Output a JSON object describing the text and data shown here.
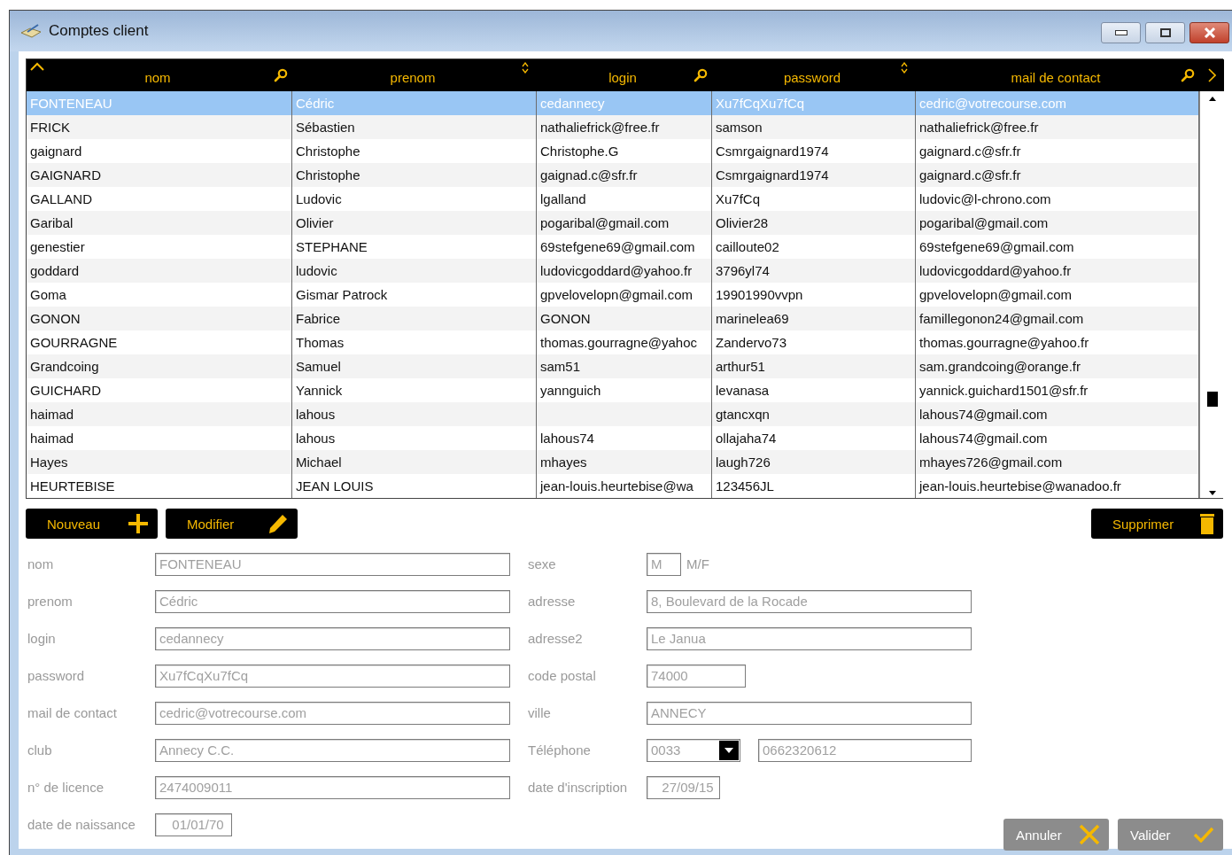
{
  "window": {
    "title": "Comptes client"
  },
  "table": {
    "columns": [
      {
        "label": "nom",
        "sorted_ascending": true,
        "sortable": false,
        "search": true
      },
      {
        "label": "prenom",
        "sorted_ascending": false,
        "sortable": true,
        "search": false
      },
      {
        "label": "login",
        "sorted_ascending": false,
        "sortable": false,
        "search": true
      },
      {
        "label": "password",
        "sorted_ascending": false,
        "sortable": true,
        "search": false
      },
      {
        "label": "mail de contact",
        "sorted_ascending": false,
        "sortable": false,
        "search": true
      }
    ],
    "rows": [
      {
        "nom": "FONTENEAU",
        "prenom": "Cédric",
        "login": "cedannecy",
        "password": "Xu7fCqXu7fCq",
        "mail_de_contact": "cedric@votrecourse.com",
        "selected": true
      },
      {
        "nom": "FRICK",
        "prenom": "Sébastien",
        "login": "nathaliefrick@free.fr",
        "password": "samson",
        "mail_de_contact": "nathaliefrick@free.fr",
        "selected": false
      },
      {
        "nom": "gaignard",
        "prenom": "Christophe",
        "login": "Christophe.G",
        "password": "Csmrgaignard1974",
        "mail_de_contact": "gaignard.c@sfr.fr",
        "selected": false
      },
      {
        "nom": "GAIGNARD",
        "prenom": "Christophe",
        "login": "gaignad.c@sfr.fr",
        "password": "Csmrgaignard1974",
        "mail_de_contact": "gaignard.c@sfr.fr",
        "selected": false
      },
      {
        "nom": "GALLAND",
        "prenom": "Ludovic",
        "login": "lgalland",
        "password": "Xu7fCq",
        "mail_de_contact": "ludovic@l-chrono.com",
        "selected": false
      },
      {
        "nom": "Garibal",
        "prenom": "Olivier",
        "login": "pogaribal@gmail.com",
        "password": "Olivier28",
        "mail_de_contact": "pogaribal@gmail.com",
        "selected": false
      },
      {
        "nom": "genestier",
        "prenom": "STEPHANE",
        "login": "69stefgene69@gmail.com",
        "password": "cailloute02",
        "mail_de_contact": "69stefgene69@gmail.com",
        "selected": false
      },
      {
        "nom": "goddard",
        "prenom": "ludovic",
        "login": "ludovicgoddard@yahoo.fr",
        "password": "3796yl74",
        "mail_de_contact": "ludovicgoddard@yahoo.fr",
        "selected": false
      },
      {
        "nom": "Goma",
        "prenom": "Gismar Patrock",
        "login": "gpvelovelopn@gmail.com",
        "password": "19901990vvpn",
        "mail_de_contact": "gpvelovelopn@gmail.com",
        "selected": false
      },
      {
        "nom": "GONON",
        "prenom": "Fabrice",
        "login": "GONON",
        "password": "marinelea69",
        "mail_de_contact": "famillegonon24@gmail.com",
        "selected": false
      },
      {
        "nom": "GOURRAGNE",
        "prenom": "Thomas",
        "login": "thomas.gourragne@yahoc",
        "password": "Zandervo73",
        "mail_de_contact": "thomas.gourragne@yahoo.fr",
        "selected": false
      },
      {
        "nom": "Grandcoing",
        "prenom": "Samuel",
        "login": "sam51",
        "password": "arthur51",
        "mail_de_contact": "sam.grandcoing@orange.fr",
        "selected": false
      },
      {
        "nom": "GUICHARD",
        "prenom": "Yannick",
        "login": "yannguich",
        "password": "levanasa",
        "mail_de_contact": "yannick.guichard1501@sfr.fr",
        "selected": false
      },
      {
        "nom": "haimad",
        "prenom": "lahous",
        "password": "gtancxqn",
        "mail_de_contact": "lahous74@gmail.com",
        "selected": false
      },
      {
        "nom": "haimad",
        "prenom": "lahous",
        "login": "lahous74",
        "password": "ollajaha74",
        "mail_de_contact": "lahous74@gmail.com",
        "selected": false
      },
      {
        "nom": "Hayes",
        "prenom": "Michael",
        "login": "mhayes",
        "password": "laugh726",
        "mail_de_contact": "mhayes726@gmail.com",
        "selected": false
      },
      {
        "nom": "HEURTEBISE",
        "prenom": "JEAN LOUIS",
        "login": "jean-louis.heurtebise@wa",
        "password": "123456JL",
        "mail_de_contact": "jean-louis.heurtebise@wanadoo.fr",
        "selected": false
      }
    ]
  },
  "top_buttons": [
    {
      "label": "Nouveau",
      "kind": "add",
      "disabled": false
    },
    {
      "label": "Modifier",
      "kind": "edit",
      "disabled": false
    },
    {
      "label": "Supprimer",
      "kind": "delete",
      "disabled": false
    }
  ],
  "form_left": [
    {
      "label": "nom",
      "kind": "wide",
      "value": "FONTENEAU"
    },
    {
      "label": "prenom",
      "kind": "wide",
      "value": "Cédric"
    },
    {
      "label": "login",
      "kind": "wide",
      "value": "cedannecy"
    },
    {
      "label": "password",
      "kind": "wide",
      "value": "Xu7fCqXu7fCq"
    },
    {
      "label": "mail de contact",
      "kind": "wide",
      "value": "cedric@votrecourse.com"
    },
    {
      "label": "club",
      "kind": "wide",
      "value": "Annecy C.C."
    },
    {
      "label": "n° de licence",
      "kind": "wide",
      "value": "2474009011"
    },
    {
      "label": "date de naissance",
      "kind": "date",
      "value": "01/01/70"
    }
  ],
  "form_right": [
    {
      "label": "sexe",
      "kind": "sex",
      "value": "M",
      "hint": "M/F"
    },
    {
      "label": "adresse",
      "kind": "wide",
      "value": "8, Boulevard de la Rocade"
    },
    {
      "label": "adresse2",
      "kind": "wide",
      "value": "Le Janua"
    },
    {
      "label": "code postal",
      "kind": "short",
      "value": "74000"
    },
    {
      "label": "ville",
      "kind": "wide",
      "value": "ANNECY"
    },
    {
      "label": "Téléphone",
      "kind": "phone",
      "value": "0033",
      "number": "0662320612"
    },
    {
      "label": "date d'inscription",
      "kind": "date",
      "value": "27/09/15"
    }
  ],
  "bottom_buttons": [
    {
      "label": "Annuler",
      "kind": "cancel",
      "disabled": true
    },
    {
      "label": "Valider",
      "kind": "confirm",
      "disabled": true
    }
  ]
}
